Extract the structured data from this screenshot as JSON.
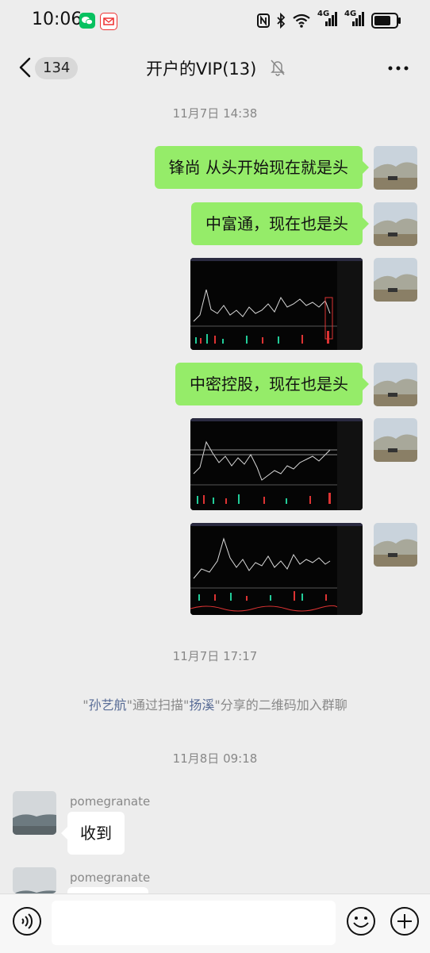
{
  "status_bar": {
    "time": "10:06",
    "network": "4G",
    "network2": "4G"
  },
  "header": {
    "unread_count": "134",
    "title": "开户的VIP(13)"
  },
  "messages": {
    "ts1": "11月7日 14:38",
    "msg1": "锋尚 从头开始现在就是头",
    "msg2": "中富通，现在也是头",
    "msg3": "中密控股，现在也是头",
    "ts2": "11月7日 17:17",
    "sys_q1": "\"",
    "sys_name1": "孙艺航",
    "sys_q2": "\"通过扫描\"",
    "sys_name2": "扬溪",
    "sys_q3": "\"分享的二维码加入群聊",
    "ts3": "11月8日 09:18",
    "sender1": "pomegranate",
    "msg4": "收到",
    "sender2": "pomegranate"
  },
  "colors": {
    "bubble_self": "#95ec69",
    "bubble_other": "#ffffff",
    "link": "#576b95",
    "background": "#ededed"
  }
}
